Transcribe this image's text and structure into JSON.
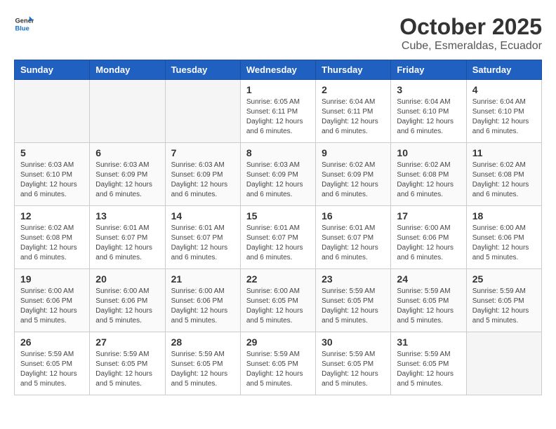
{
  "logo": {
    "text_general": "General",
    "text_blue": "Blue"
  },
  "title": "October 2025",
  "subtitle": "Cube, Esmeraldas, Ecuador",
  "weekdays": [
    "Sunday",
    "Monday",
    "Tuesday",
    "Wednesday",
    "Thursday",
    "Friday",
    "Saturday"
  ],
  "weeks": [
    [
      {
        "day": "",
        "empty": true
      },
      {
        "day": "",
        "empty": true
      },
      {
        "day": "",
        "empty": true
      },
      {
        "day": "1",
        "sunrise": "6:05 AM",
        "sunset": "6:11 PM",
        "daylight": "12 hours and 6 minutes."
      },
      {
        "day": "2",
        "sunrise": "6:04 AM",
        "sunset": "6:11 PM",
        "daylight": "12 hours and 6 minutes."
      },
      {
        "day": "3",
        "sunrise": "6:04 AM",
        "sunset": "6:10 PM",
        "daylight": "12 hours and 6 minutes."
      },
      {
        "day": "4",
        "sunrise": "6:04 AM",
        "sunset": "6:10 PM",
        "daylight": "12 hours and 6 minutes."
      }
    ],
    [
      {
        "day": "5",
        "sunrise": "6:03 AM",
        "sunset": "6:10 PM",
        "daylight": "12 hours and 6 minutes."
      },
      {
        "day": "6",
        "sunrise": "6:03 AM",
        "sunset": "6:09 PM",
        "daylight": "12 hours and 6 minutes."
      },
      {
        "day": "7",
        "sunrise": "6:03 AM",
        "sunset": "6:09 PM",
        "daylight": "12 hours and 6 minutes."
      },
      {
        "day": "8",
        "sunrise": "6:03 AM",
        "sunset": "6:09 PM",
        "daylight": "12 hours and 6 minutes."
      },
      {
        "day": "9",
        "sunrise": "6:02 AM",
        "sunset": "6:09 PM",
        "daylight": "12 hours and 6 minutes."
      },
      {
        "day": "10",
        "sunrise": "6:02 AM",
        "sunset": "6:08 PM",
        "daylight": "12 hours and 6 minutes."
      },
      {
        "day": "11",
        "sunrise": "6:02 AM",
        "sunset": "6:08 PM",
        "daylight": "12 hours and 6 minutes."
      }
    ],
    [
      {
        "day": "12",
        "sunrise": "6:02 AM",
        "sunset": "6:08 PM",
        "daylight": "12 hours and 6 minutes."
      },
      {
        "day": "13",
        "sunrise": "6:01 AM",
        "sunset": "6:07 PM",
        "daylight": "12 hours and 6 minutes."
      },
      {
        "day": "14",
        "sunrise": "6:01 AM",
        "sunset": "6:07 PM",
        "daylight": "12 hours and 6 minutes."
      },
      {
        "day": "15",
        "sunrise": "6:01 AM",
        "sunset": "6:07 PM",
        "daylight": "12 hours and 6 minutes."
      },
      {
        "day": "16",
        "sunrise": "6:01 AM",
        "sunset": "6:07 PM",
        "daylight": "12 hours and 6 minutes."
      },
      {
        "day": "17",
        "sunrise": "6:00 AM",
        "sunset": "6:06 PM",
        "daylight": "12 hours and 6 minutes."
      },
      {
        "day": "18",
        "sunrise": "6:00 AM",
        "sunset": "6:06 PM",
        "daylight": "12 hours and 5 minutes."
      }
    ],
    [
      {
        "day": "19",
        "sunrise": "6:00 AM",
        "sunset": "6:06 PM",
        "daylight": "12 hours and 5 minutes."
      },
      {
        "day": "20",
        "sunrise": "6:00 AM",
        "sunset": "6:06 PM",
        "daylight": "12 hours and 5 minutes."
      },
      {
        "day": "21",
        "sunrise": "6:00 AM",
        "sunset": "6:06 PM",
        "daylight": "12 hours and 5 minutes."
      },
      {
        "day": "22",
        "sunrise": "6:00 AM",
        "sunset": "6:05 PM",
        "daylight": "12 hours and 5 minutes."
      },
      {
        "day": "23",
        "sunrise": "5:59 AM",
        "sunset": "6:05 PM",
        "daylight": "12 hours and 5 minutes."
      },
      {
        "day": "24",
        "sunrise": "5:59 AM",
        "sunset": "6:05 PM",
        "daylight": "12 hours and 5 minutes."
      },
      {
        "day": "25",
        "sunrise": "5:59 AM",
        "sunset": "6:05 PM",
        "daylight": "12 hours and 5 minutes."
      }
    ],
    [
      {
        "day": "26",
        "sunrise": "5:59 AM",
        "sunset": "6:05 PM",
        "daylight": "12 hours and 5 minutes."
      },
      {
        "day": "27",
        "sunrise": "5:59 AM",
        "sunset": "6:05 PM",
        "daylight": "12 hours and 5 minutes."
      },
      {
        "day": "28",
        "sunrise": "5:59 AM",
        "sunset": "6:05 PM",
        "daylight": "12 hours and 5 minutes."
      },
      {
        "day": "29",
        "sunrise": "5:59 AM",
        "sunset": "6:05 PM",
        "daylight": "12 hours and 5 minutes."
      },
      {
        "day": "30",
        "sunrise": "5:59 AM",
        "sunset": "6:05 PM",
        "daylight": "12 hours and 5 minutes."
      },
      {
        "day": "31",
        "sunrise": "5:59 AM",
        "sunset": "6:05 PM",
        "daylight": "12 hours and 5 minutes."
      },
      {
        "day": "",
        "empty": true
      }
    ]
  ]
}
